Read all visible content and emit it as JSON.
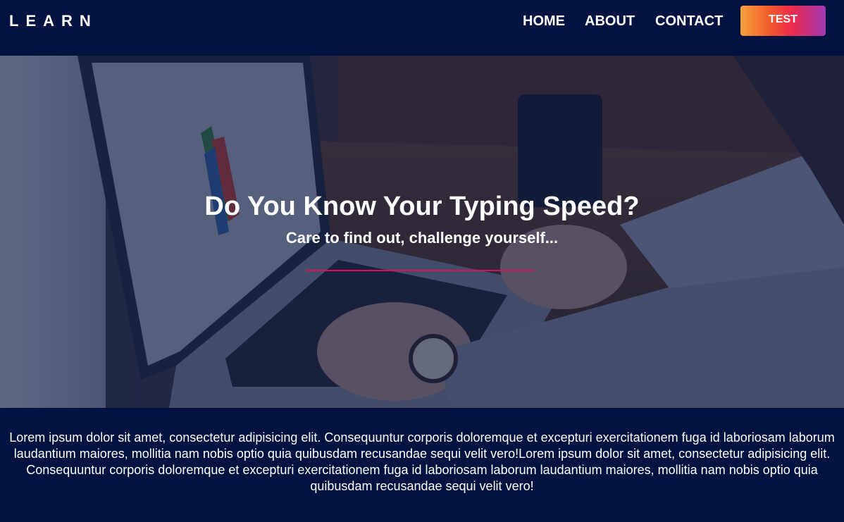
{
  "navbar": {
    "logo": "LEARN",
    "links": [
      {
        "label": "HOME"
      },
      {
        "label": "ABOUT"
      },
      {
        "label": "CONTACT"
      }
    ],
    "cta_label": "TEST"
  },
  "hero": {
    "title": "Do You Know Your Typing Speed?",
    "subtitle": "Care to find out, challenge yourself...",
    "image_description": "person-typing-on-laptop-photo"
  },
  "main": {
    "paragraph": "Lorem ipsum dolor sit amet, consectetur adipisicing elit. Consequuntur corporis doloremque et excepturi exercitationem fuga id laboriosam laborum laudantium maiores, mollitia nam nobis optio quia quibusdam recusandae sequi velit vero!Lorem ipsum dolor sit amet, consectetur adipisicing elit. Consequuntur corporis doloremque et excepturi exercitationem fuga id laboriosam laborum laudantium maiores, mollitia nam nobis optio quia quibusdam recusandae sequi velit vero!"
  },
  "colors": {
    "navy_background": "#021342",
    "accent_line": "#d3125f",
    "button_gradient_start": "#f7a23b",
    "button_gradient_end": "#a039b5"
  }
}
